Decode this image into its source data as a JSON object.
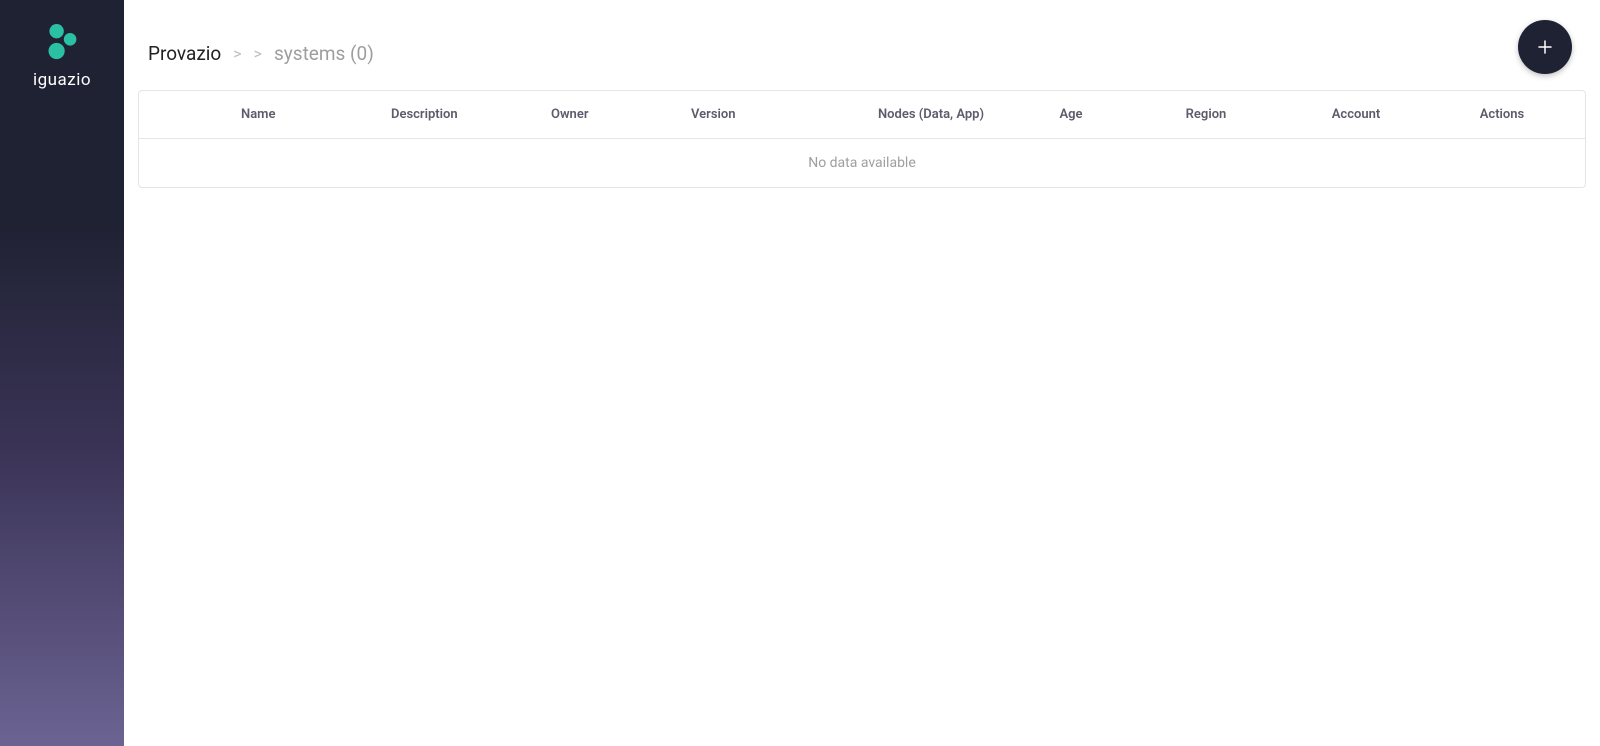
{
  "brand": {
    "name": "iguazio"
  },
  "breadcrumb": {
    "root": "Provazio",
    "sep": ">",
    "current": "systems (0)"
  },
  "table": {
    "columns": {
      "name": "Name",
      "description": "Description",
      "owner": "Owner",
      "version": "Version",
      "nodes": "Nodes (Data, App)",
      "age": "Age",
      "region": "Region",
      "account": "Account",
      "actions": "Actions"
    },
    "empty_message": "No data available",
    "rows": []
  }
}
